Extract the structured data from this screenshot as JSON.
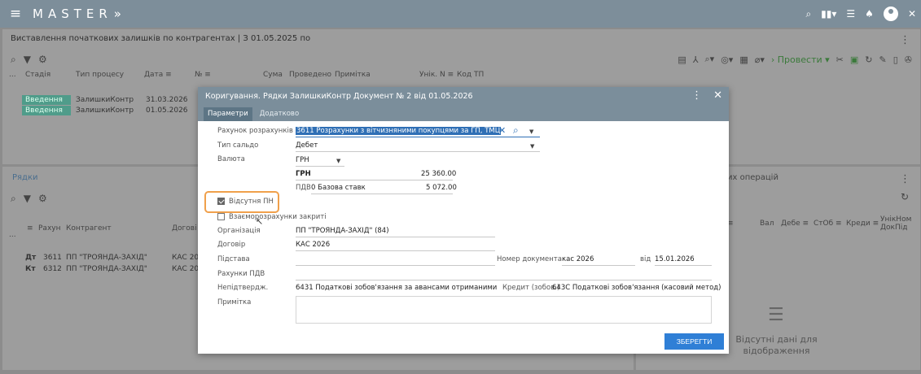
{
  "app": {
    "brand": "MASTER",
    "brand_suffix": "»",
    "menu_icon": "≡"
  },
  "topbar_icons": [
    "search-icon",
    "chart-icon",
    "filter-icon",
    "bell-icon",
    "user-icon",
    "close-icon"
  ],
  "upper": {
    "title": "Виставлення початкових залишків по контрагентах | З 01.05.2025 по",
    "columns": [
      "...",
      "Стадія",
      "Тип процесу",
      "Дата ≡",
      "№ ≡",
      "Сума",
      "Проведено",
      "Примітка",
      "Унік. N ≡",
      "Код ТП"
    ],
    "rows": [
      {
        "stage": "Введення",
        "type": "ЗалишкиКонтр",
        "date": "31.03.2026"
      },
      {
        "stage": "Введення",
        "type": "ЗалишкиКонтр",
        "date": "01.05.2026"
      }
    ],
    "post_label": "Провести"
  },
  "lower": {
    "title": "Рядки",
    "columns": [
      "...",
      "≡",
      "Рахун",
      "Контрагент",
      "Догові"
    ],
    "rows": [
      {
        "side": "Дт",
        "account": "3611",
        "contractor": "ПП \"ТРОЯНДА-ЗАХІД\"",
        "contract": "КАС 20"
      },
      {
        "side": "Кт",
        "account": "6312",
        "contractor": "ПП \"ТРОЯНДА-ЗАХІД\"",
        "contract": "КАС 20"
      }
    ]
  },
  "lowright": {
    "title": "их операцій",
    "columns": [
      "≡",
      "Вал",
      "Дебе ≡",
      "СтОб ≡",
      "Креди ≡",
      "УнікНом ДокПід"
    ],
    "nodata_line1": "Відсутні дані для",
    "nodata_line2": "відображення"
  },
  "modal": {
    "title": "Коригування. Рядки ЗалишкиКонтр Документ № 2 від 01.05.2026",
    "tabs": [
      "Параметри",
      "Додатково"
    ],
    "account_label": "Рахунок розрахунків",
    "account_value": "3611 Розрахунки з вітчизняними покупцями за ГП, ТМЦ",
    "balance_type_label": "Тип сальдо",
    "balance_type_value": "Дебет",
    "currency_label": "Валюта",
    "currency_value": "ГРН",
    "currency_row_label": "ГРН",
    "currency_amount": "25 360.00",
    "vat_label": "ПДВ",
    "vat_rate": "0 Базова ставк",
    "vat_amount": "5 072.00",
    "no_tax_invoice_label": "Відсутня ПН",
    "no_tax_invoice_checked": true,
    "settlements_closed_label": "Взаєморозрахунки закриті",
    "settlements_closed_checked": false,
    "org_label": "Організація",
    "org_value": "ПП \"ТРОЯНДА-ЗАХІД\" (84)",
    "contract_label": "Договір",
    "contract_value": "КАС 2026",
    "basis_label": "Підстава",
    "doc_number_label": "Номер документа",
    "doc_number_value": "кас 2026",
    "from_label": "від",
    "from_value": "15.01.2026",
    "vat_accounts_label": "Рахунки ПДВ",
    "unconfirmed_label": "Непідтвердж.",
    "unconfirmed_value": "6431 Податкові зобов'язання за авансами отриманими",
    "credit_label": "Кредит (зобов.)",
    "credit_value": "643С Податкові зобов'язання (касовий метод)",
    "note_label": "Примітка",
    "save_label": "ЗБЕРЕГТИ"
  }
}
